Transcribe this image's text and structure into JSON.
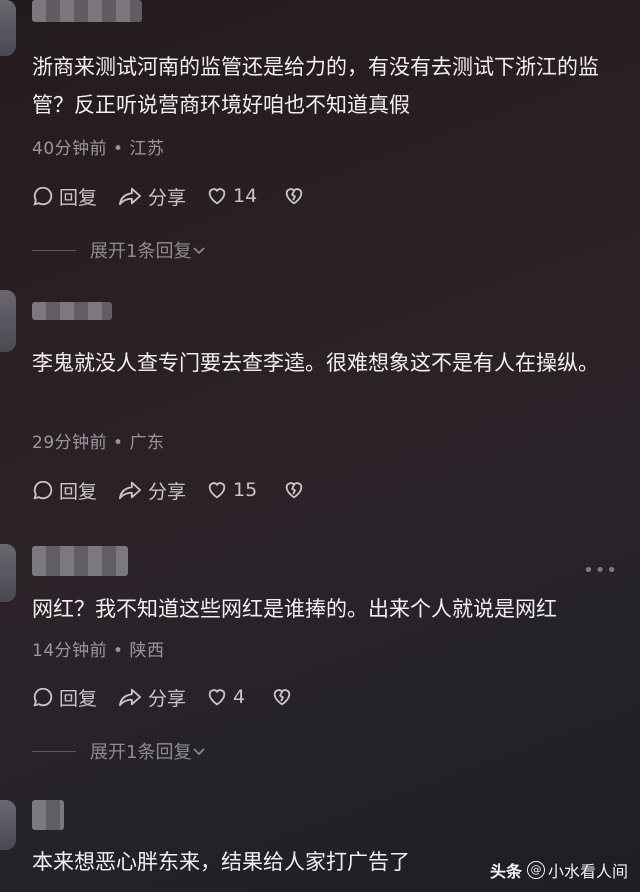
{
  "comments": [
    {
      "text": "浙商来测试河南的监管还是给力的，有没有去测试下浙江的监管？反正听说营商环境好咱也不知道真假",
      "time": "40分钟前",
      "location": "江苏",
      "reply_label": "回复",
      "share_label": "分享",
      "likes": "14",
      "expand_label": "展开1条回复"
    },
    {
      "text": "李鬼就没人查专门要去查李逵。很难想象这不是有人在操纵。",
      "time": "29分钟前",
      "location": "广东",
      "reply_label": "回复",
      "share_label": "分享",
      "likes": "15"
    },
    {
      "text": "网红？我不知道这些网红是谁捧的。出来个人就说是网红",
      "time": "14分钟前",
      "location": "陕西",
      "reply_label": "回复",
      "share_label": "分享",
      "likes": "4",
      "expand_label": "展开1条回复"
    },
    {
      "text": "本来想恶心胖东来，结果给人家打广告了"
    }
  ],
  "meta_separator": "•",
  "more_label": "•••",
  "watermark": {
    "brand": "头条",
    "account": "小水看人间"
  }
}
